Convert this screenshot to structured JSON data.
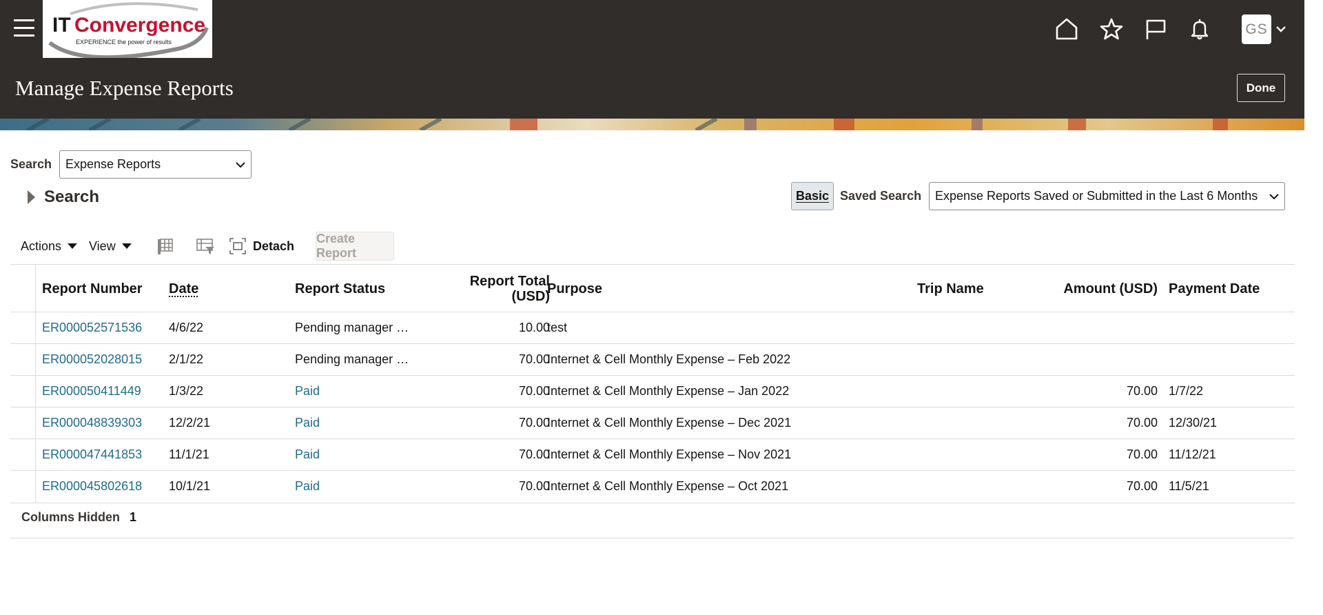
{
  "header": {
    "logo_text": "ITConvergence",
    "logo_tagline": "EXPERIENCE the power of results",
    "icons": [
      "home-icon",
      "favorites-star-icon",
      "flag-icon",
      "bell-icon"
    ],
    "avatar_initials": "GS",
    "page_title": "Manage Expense Reports",
    "done_label": "Done"
  },
  "search": {
    "label": "Search",
    "selected": "Expense Reports",
    "disclosure_label": "Search",
    "basic_label": "Basic",
    "saved_search_label": "Saved Search",
    "saved_search_value": "Expense Reports Saved or Submitted in the Last 6 Months"
  },
  "toolbar": {
    "actions_label": "Actions",
    "view_label": "View",
    "detach_label": "Detach",
    "create_report_label": "Create Report"
  },
  "table": {
    "columns": [
      "Report Number",
      "Date",
      "Report Status",
      "Report Total (USD)",
      "Purpose",
      "Trip Name",
      "Amount (USD)",
      "Payment Date"
    ],
    "report_total_line1": "Report Total",
    "report_total_line2": "(USD)",
    "rows": [
      {
        "number": "ER000052571536",
        "date": "4/6/22",
        "status": "Pending manager …",
        "status_link": false,
        "total": "10.00",
        "purpose": "test",
        "trip": "",
        "amount": "",
        "payment_date": ""
      },
      {
        "number": "ER000052028015",
        "date": "2/1/22",
        "status": "Pending manager …",
        "status_link": false,
        "total": "70.00",
        "purpose": "Internet & Cell Monthly Expense – Feb 2022",
        "trip": "",
        "amount": "",
        "payment_date": ""
      },
      {
        "number": "ER000050411449",
        "date": "1/3/22",
        "status": "Paid",
        "status_link": true,
        "total": "70.00",
        "purpose": "Internet & Cell Monthly Expense – Jan 2022",
        "trip": "",
        "amount": "70.00",
        "payment_date": "1/7/22"
      },
      {
        "number": "ER000048839303",
        "date": "12/2/21",
        "status": "Paid",
        "status_link": true,
        "total": "70.00",
        "purpose": "Internet & Cell Monthly Expense – Dec 2021",
        "trip": "",
        "amount": "70.00",
        "payment_date": "12/30/21"
      },
      {
        "number": "ER000047441853",
        "date": "11/1/21",
        "status": "Paid",
        "status_link": true,
        "total": "70.00",
        "purpose": "Internet & Cell Monthly Expense – Nov 2021",
        "trip": "",
        "amount": "70.00",
        "payment_date": "11/12/21"
      },
      {
        "number": "ER000045802618",
        "date": "10/1/21",
        "status": "Paid",
        "status_link": true,
        "total": "70.00",
        "purpose": "Internet & Cell Monthly Expense – Oct 2021",
        "trip": "",
        "amount": "70.00",
        "payment_date": "11/5/21"
      }
    ]
  },
  "footer": {
    "columns_hidden_label": "Columns Hidden",
    "columns_hidden_count": "1"
  },
  "colors": {
    "header_bg": "#312d2a",
    "link": "#1f6b8a"
  }
}
